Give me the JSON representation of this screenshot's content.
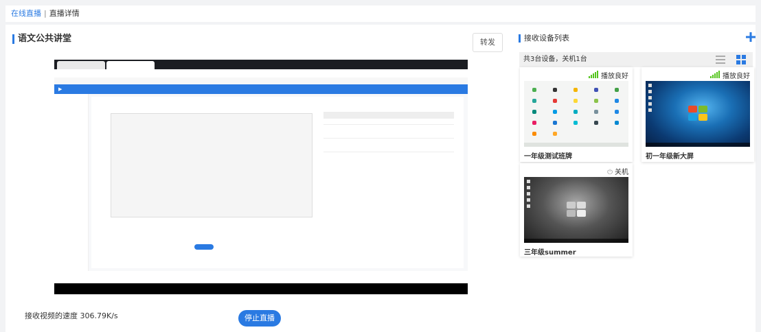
{
  "breadcrumb": {
    "parent": "在线直播",
    "separator": "|",
    "current": "直播详情"
  },
  "live": {
    "title": "语文公共讲堂",
    "forward_label": "转发",
    "speed_text": "接收视频的速度 306.79K/s",
    "stop_label": "停止直播"
  },
  "devices": {
    "panel_title": "接收设备列表",
    "summary": "共3台设备，关机1台",
    "items": [
      {
        "name": "一年级测试班牌",
        "status": "",
        "thumb": "android-app-grid"
      },
      {
        "name": "初一年级新大屏",
        "status": "播放良好",
        "thumb": "windows-7-desktop"
      },
      {
        "name": "三年级summer",
        "status": "关机",
        "thumb": "windows-7-desktop-gray"
      }
    ],
    "card1_status": "播放良好"
  },
  "colors": {
    "accent": "#2a7ae2",
    "signal_good": "#52c41a"
  }
}
